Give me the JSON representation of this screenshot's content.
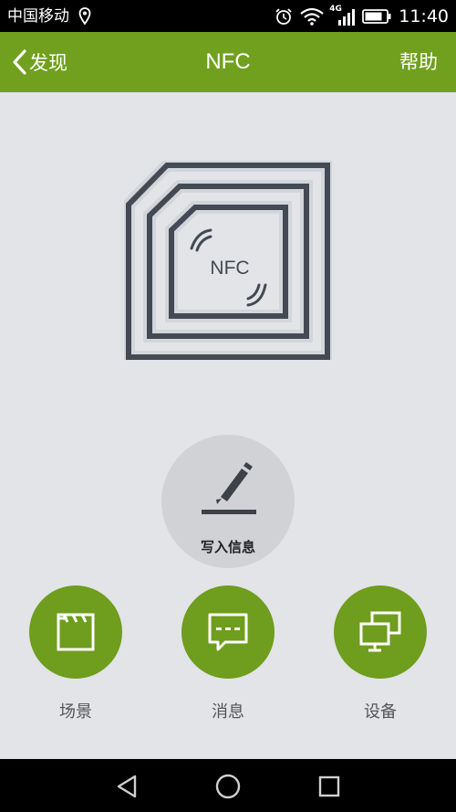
{
  "status_bar": {
    "carrier": "中国移动",
    "network": "4G",
    "time": "11:40",
    "icons": [
      "location-pin-icon",
      "alarm-icon",
      "wifi-icon",
      "signal-icon",
      "battery-icon"
    ]
  },
  "header": {
    "back_label": "发现",
    "title": "NFC",
    "help_label": "帮助",
    "background": "#70a01e"
  },
  "illustration": {
    "nfc_text": "NFC"
  },
  "write": {
    "label": "写入信息",
    "icon": "pen-icon"
  },
  "actions": [
    {
      "label": "场景",
      "icon": "clapperboard-icon"
    },
    {
      "label": "消息",
      "icon": "message-bubble-icon"
    },
    {
      "label": "设备",
      "icon": "monitors-icon"
    }
  ],
  "nav_bar": {
    "icons": [
      "back-triangle-icon",
      "home-circle-icon",
      "recents-square-icon"
    ]
  },
  "colors": {
    "accent_green": "#70a01e",
    "background": "#e2e4e8",
    "icon_dark": "#444a52"
  }
}
